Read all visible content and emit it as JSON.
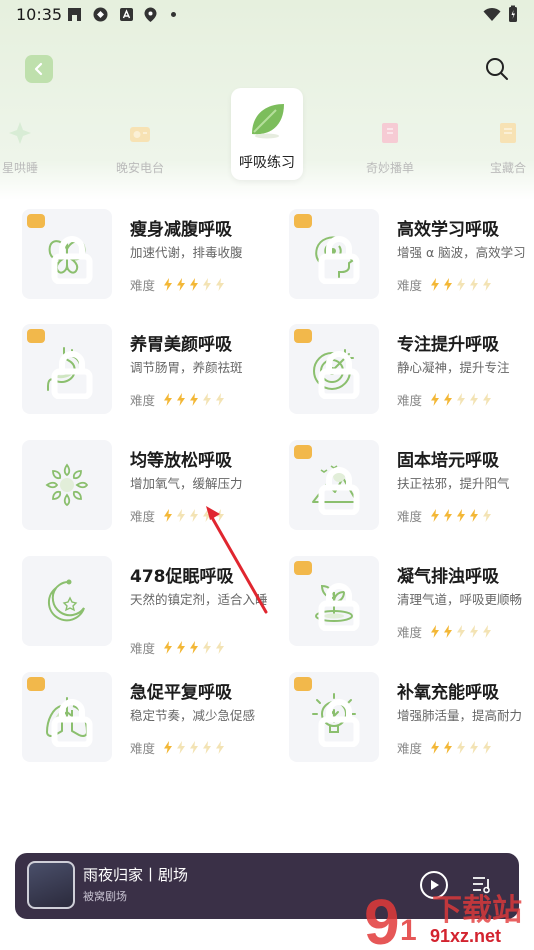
{
  "status_bar": {
    "time": "10:35"
  },
  "tabs": [
    {
      "label": "星哄睡"
    },
    {
      "label": "晚安电台"
    },
    {
      "label": "呼吸练习",
      "active": true
    },
    {
      "label": "奇妙播单"
    },
    {
      "label": "宝藏合"
    }
  ],
  "difficulty_label": "难度",
  "cards": [
    {
      "title": "瘦身减腹呼吸",
      "desc": "加速代谢，排毒收腹",
      "difficulty": 3,
      "icon": "butterfly-icon"
    },
    {
      "title": "高效学习呼吸",
      "desc": "增强 α 脑波，高效学习",
      "difficulty": 2,
      "icon": "head-icon"
    },
    {
      "title": "养胃美颜呼吸",
      "desc": "调节肠胃，养颜祛斑",
      "difficulty": 3,
      "icon": "stomach-icon"
    },
    {
      "title": "专注提升呼吸",
      "desc": "静心凝神，提升专注",
      "difficulty": 2,
      "icon": "target-icon"
    },
    {
      "title": "均等放松呼吸",
      "desc": "增加氧气，缓解压力",
      "difficulty": 1,
      "icon": "leaf-ring-icon"
    },
    {
      "title": "固本培元呼吸",
      "desc": "扶正祛邪，提升阳气",
      "difficulty": 4,
      "icon": "mountain-icon"
    },
    {
      "title": "478促眠呼吸",
      "desc": "天然的镇定剂，适合入睡",
      "difficulty": 3,
      "icon": "moon-icon"
    },
    {
      "title": "凝气排浊呼吸",
      "desc": "清理气道，呼吸更顺畅",
      "difficulty": 2,
      "icon": "plant-icon"
    },
    {
      "title": "急促平复呼吸",
      "desc": "稳定节奏，减少急促感",
      "difficulty": 1,
      "icon": "lungs-icon"
    },
    {
      "title": "补氧充能呼吸",
      "desc": "增强肺活量，提高耐力",
      "difficulty": 2,
      "icon": "bulb-icon"
    }
  ],
  "player": {
    "title": "雨夜归家丨剧场",
    "subtitle": "被窝剧场"
  },
  "watermark": {
    "text": "91xz.net"
  },
  "colors": {
    "accent": "#8bbf6e",
    "bolt_on": "#f3b736",
    "bolt_off": "#f3e3b4",
    "player_bg": "#3a3047"
  }
}
